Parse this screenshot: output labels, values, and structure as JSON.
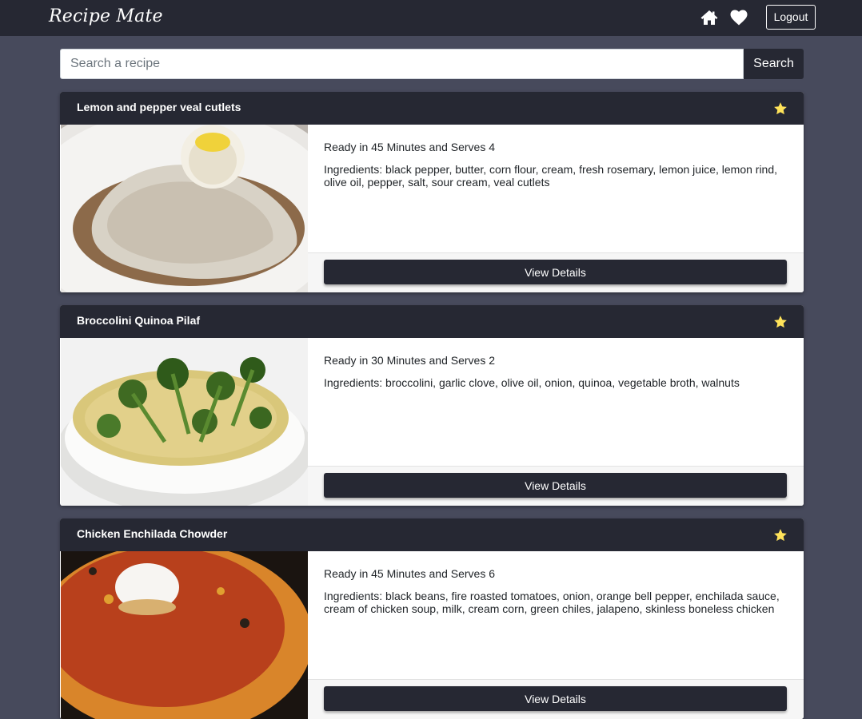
{
  "app": {
    "brand": "Recipe Mate",
    "nav_icons": [
      "home-icon",
      "heart-icon"
    ],
    "logout_label": "Logout"
  },
  "search": {
    "placeholder": "Search a recipe",
    "value": "",
    "button_label": "Search"
  },
  "colors": {
    "page_background": "#474a5c",
    "dark": "#262833",
    "star": "#ffe35a"
  },
  "recipes": [
    {
      "title": "Lemon and pepper veal cutlets",
      "ready_text": "Ready in 45 Minutes and Serves 4",
      "ingredients_text": "Ingredients: black pepper, butter, corn flour, cream, fresh rosemary, lemon juice, lemon rind, olive oil, pepper, salt, sour cream, veal cutlets",
      "favorite_icon": "star-icon",
      "details_label": "View Details"
    },
    {
      "title": "Broccolini Quinoa Pilaf",
      "ready_text": "Ready in 30 Minutes and Serves 2",
      "ingredients_text": "Ingredients: broccolini, garlic clove, olive oil, onion, quinoa, vegetable broth, walnuts",
      "favorite_icon": "star-icon",
      "details_label": "View Details"
    },
    {
      "title": "Chicken Enchilada Chowder",
      "ready_text": "Ready in 45 Minutes and Serves 6",
      "ingredients_text": "Ingredients: black beans, fire roasted tomatoes, onion, orange bell pepper, enchilada sauce, cream of chicken soup, milk, cream corn, green chiles, jalapeno, skinless boneless chicken",
      "favorite_icon": "star-icon",
      "details_label": "View Details"
    }
  ]
}
